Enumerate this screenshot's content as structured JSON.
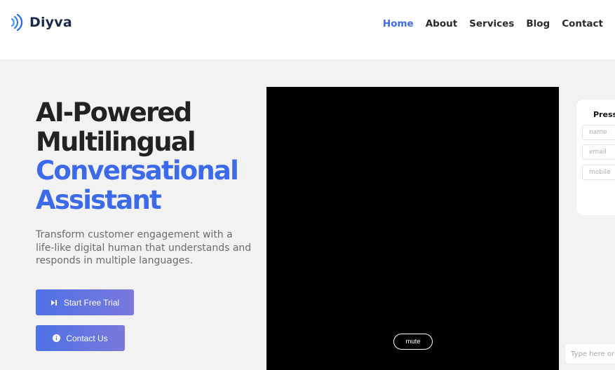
{
  "header": {
    "logo_text": "Diyva",
    "nav": [
      {
        "label": "Home",
        "active": true
      },
      {
        "label": "About",
        "active": false
      },
      {
        "label": "Services",
        "active": false
      },
      {
        "label": "Blog",
        "active": false
      },
      {
        "label": "Contact",
        "active": false
      }
    ]
  },
  "hero": {
    "title_line1": "AI-Powered",
    "title_line2": "Multilingual",
    "title_line3": "Conversational",
    "title_line4": "Assistant",
    "subtitle": "Transform customer engagement with a life-like digital human that understands and responds in multiple languages.",
    "trial_button": "Start Free Trial",
    "contact_button": "Contact Us"
  },
  "video": {
    "mute_label": "mute"
  },
  "form": {
    "title": "Press T",
    "name_placeholder": "name",
    "email_placeholder": "email",
    "mobile_placeholder": "mobile"
  },
  "chat": {
    "placeholder": "Type here or c"
  },
  "colors": {
    "accent": "#3d6ae8",
    "button_gradient_start": "#4e72e6",
    "button_gradient_end": "#7a78dc",
    "title_dark": "#222222"
  },
  "icons": {
    "logo": "sound-wave-logo-icon",
    "trial": "play-pause-icon",
    "contact": "info-icon"
  }
}
